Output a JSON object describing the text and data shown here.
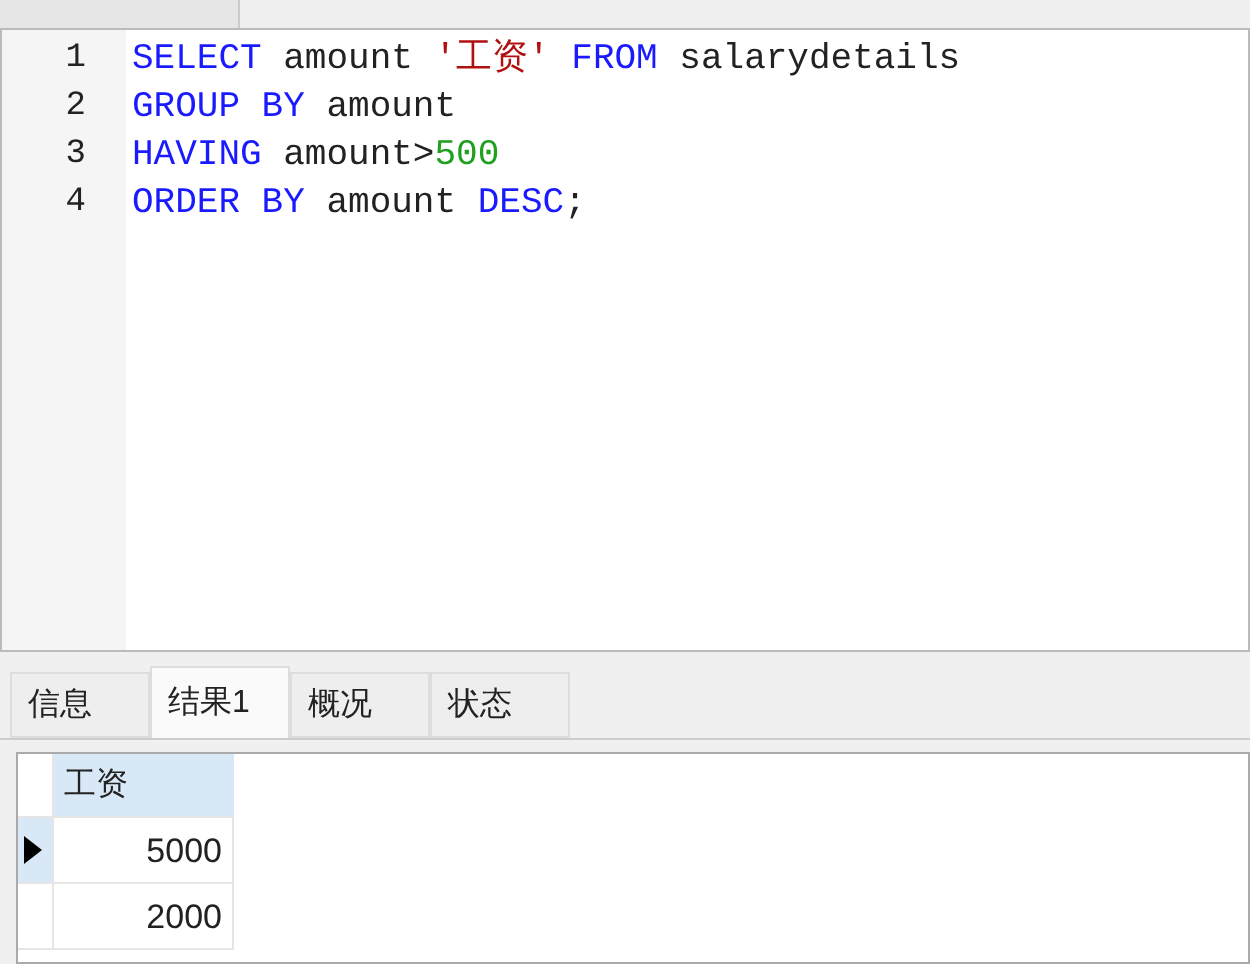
{
  "editor": {
    "lines": [
      {
        "number": "1",
        "tokens": [
          {
            "kind": "keyword",
            "text": "SELECT"
          },
          {
            "kind": "plain",
            "text": " amount "
          },
          {
            "kind": "string",
            "text": "'工资'"
          },
          {
            "kind": "keyword",
            "text": " FROM"
          },
          {
            "kind": "plain",
            "text": " salarydetails"
          }
        ]
      },
      {
        "number": "2",
        "tokens": [
          {
            "kind": "keyword",
            "text": "GROUP BY"
          },
          {
            "kind": "plain",
            "text": " amount"
          }
        ]
      },
      {
        "number": "3",
        "tokens": [
          {
            "kind": "keyword",
            "text": "HAVING"
          },
          {
            "kind": "plain",
            "text": " amount>"
          },
          {
            "kind": "number",
            "text": "500"
          }
        ]
      },
      {
        "number": "4",
        "tokens": [
          {
            "kind": "keyword",
            "text": "ORDER BY"
          },
          {
            "kind": "plain",
            "text": " amount "
          },
          {
            "kind": "keyword",
            "text": "DESC"
          },
          {
            "kind": "plain",
            "text": ";"
          }
        ]
      }
    ]
  },
  "result_tabs": [
    {
      "label": "信息",
      "selected": false
    },
    {
      "label": "结果1",
      "selected": true
    },
    {
      "label": "概况",
      "selected": false
    },
    {
      "label": "状态",
      "selected": false
    }
  ],
  "grid": {
    "columns": [
      "工资"
    ],
    "rows": [
      {
        "cells": [
          "5000"
        ],
        "selected": true
      },
      {
        "cells": [
          "2000"
        ],
        "selected": false
      }
    ]
  }
}
